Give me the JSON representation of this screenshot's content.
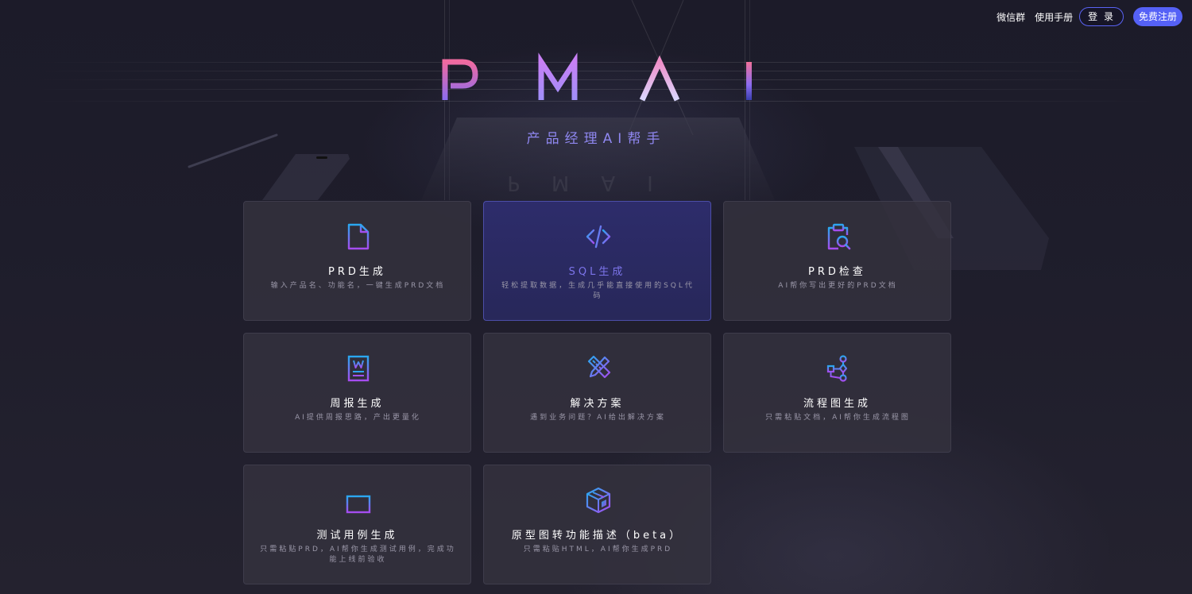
{
  "nav": {
    "wechat_group": "微信群",
    "manual": "使用手册",
    "login": "登 录",
    "register": "免费注册"
  },
  "hero": {
    "logo_text": "P M A I",
    "subtitle": "产品经理AI帮手"
  },
  "colors": {
    "accent": "#5561f6",
    "subtitle": "#8f87f0",
    "active_card_title": "#7c74ea"
  },
  "cards": [
    {
      "icon": "document-icon",
      "title": "PRD生成",
      "desc": "输入产品名、功能名，一键生成PRD文档"
    },
    {
      "icon": "code-icon",
      "title": "SQL生成",
      "desc": "轻松提取数据，生成几乎能直接使用的SQL代码"
    },
    {
      "icon": "clipboard-search-icon",
      "title": "PRD检查",
      "desc": "AI帮你写出更好的PRD文档"
    },
    {
      "icon": "word-document-icon",
      "title": "周报生成",
      "desc": "AI提供周报思路，产出更量化"
    },
    {
      "icon": "pencil-ruler-icon",
      "title": "解决方案",
      "desc": "遇到业务问题？AI给出解决方案"
    },
    {
      "icon": "flowchart-icon",
      "title": "流程图生成",
      "desc": "只需粘贴文档，AI帮你生成流程图"
    },
    {
      "icon": "stack-icon",
      "title": "测试用例生成",
      "desc": "只需粘贴PRD，AI帮你生成测试用例，完成功能上线前验收"
    },
    {
      "icon": "cube-icon",
      "title": "原型图转功能描述（beta）",
      "desc": "只需粘贴HTML，AI帮你生成PRD"
    }
  ]
}
